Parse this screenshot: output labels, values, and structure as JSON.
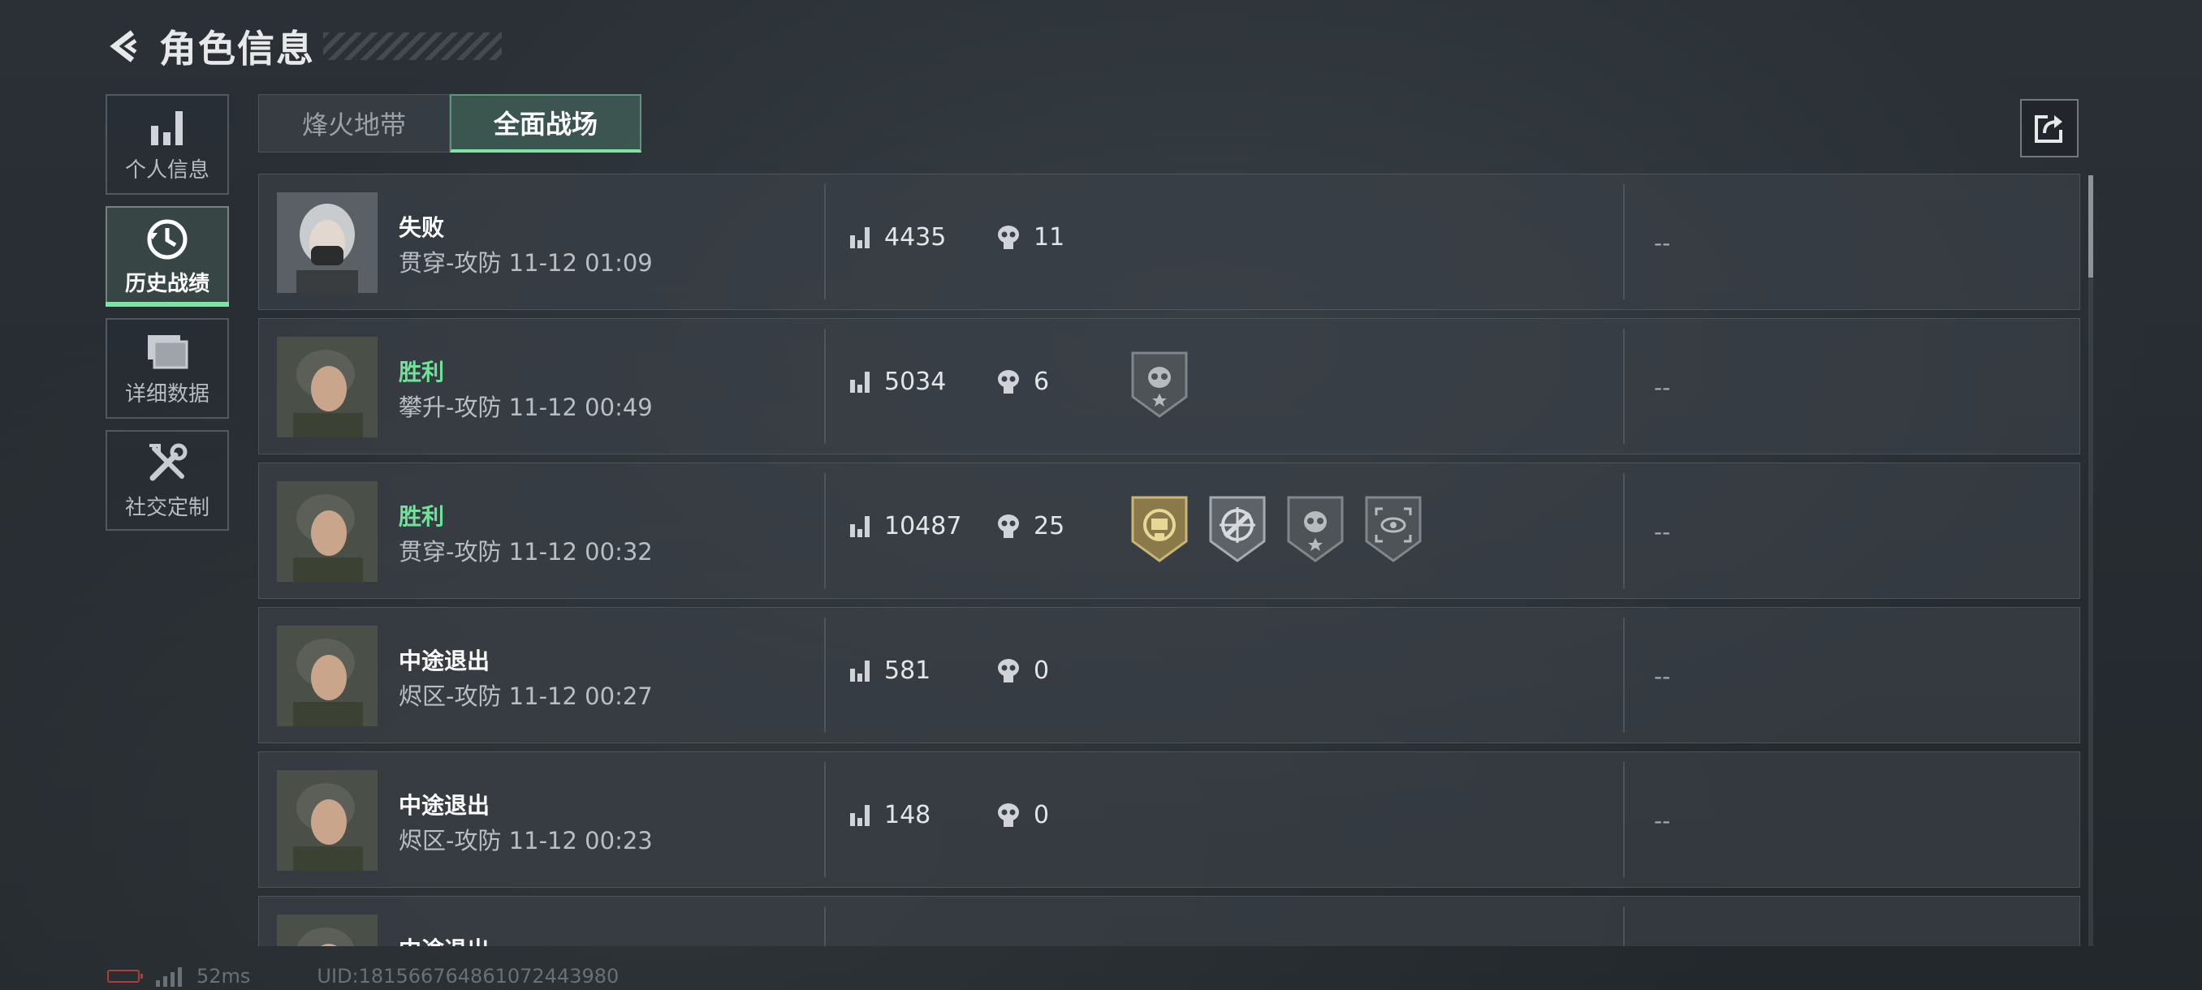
{
  "header": {
    "title": "角色信息"
  },
  "sidebar": {
    "items": [
      {
        "label": "个人信息",
        "icon": "bar-chart-icon"
      },
      {
        "label": "历史战绩",
        "icon": "history-clock-icon"
      },
      {
        "label": "详细数据",
        "icon": "folder-icon"
      },
      {
        "label": "社交定制",
        "icon": "tools-icon"
      }
    ],
    "active_index": 1
  },
  "tabs": [
    {
      "label": "烽火地带",
      "active": false
    },
    {
      "label": "全面战场",
      "active": true
    }
  ],
  "records": [
    {
      "result": "失败",
      "win": false,
      "mode": "贯穿-攻防 11-12 01:09",
      "score": "4435",
      "kills": "11",
      "medals": [],
      "extra": "--",
      "avatar": "female-masked-operator"
    },
    {
      "result": "胜利",
      "win": true,
      "mode": "攀升-攻防 11-12 00:49",
      "score": "5034",
      "kills": "6",
      "medals": [
        "skull-star-medal"
      ],
      "extra": "--",
      "avatar": "female-operator"
    },
    {
      "result": "胜利",
      "win": true,
      "mode": "贯穿-攻防 11-12 00:32",
      "score": "10487",
      "kills": "25",
      "medals": [
        "gold-vehicle-medal",
        "crosshair-rifle-medal",
        "skull-star-medal",
        "eye-target-medal"
      ],
      "extra": "--",
      "avatar": "female-operator"
    },
    {
      "result": "中途退出",
      "win": false,
      "mode": "烬区-攻防 11-12 00:27",
      "score": "581",
      "kills": "0",
      "medals": [],
      "extra": "--",
      "avatar": "female-operator"
    },
    {
      "result": "中途退出",
      "win": false,
      "mode": "烬区-攻防 11-12 00:23",
      "score": "148",
      "kills": "0",
      "medals": [],
      "extra": "--",
      "avatar": "female-operator"
    },
    {
      "result": "中途退出",
      "win": false,
      "mode": "",
      "score": "",
      "kills": "",
      "medals": [],
      "extra": "",
      "avatar": "female-operator"
    }
  ],
  "status": {
    "ping": "52ms",
    "uid": "UID:1815667648610724439​80"
  },
  "colors": {
    "win": "#6fe39a",
    "accent": "#7fe3a4",
    "battery_low": "#b23a3a"
  }
}
